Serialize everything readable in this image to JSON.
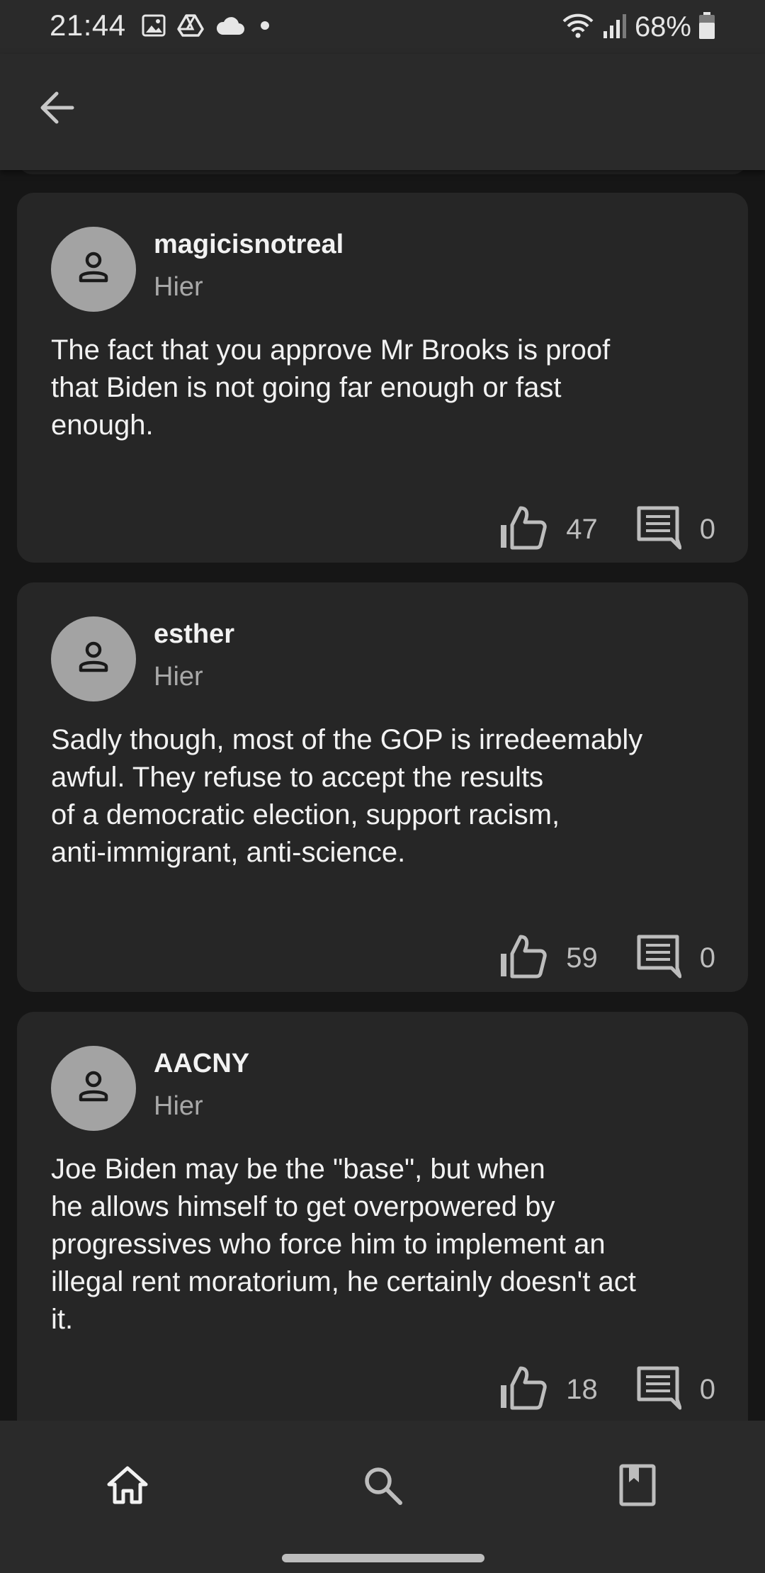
{
  "status_bar": {
    "time": "21:44",
    "battery": "68%",
    "left_icons": [
      "image-icon",
      "drive-icon",
      "cloud-icon",
      "dot-icon"
    ],
    "right_icons": [
      "wifi-icon",
      "signal-icon",
      "battery-icon"
    ]
  },
  "app_bar": {
    "back_icon": "arrow-back-icon"
  },
  "comments": [
    {
      "author": "magicisnotreal",
      "time": "Hier",
      "body": "The fact that you approve Mr Brooks is proof\nthat Biden is not going far enough or fast\nenough.",
      "likes": "47",
      "replies": "0"
    },
    {
      "author": "esther",
      "time": "Hier",
      "body": "Sadly though, most of the GOP is irredeemably\nawful. They refuse to accept the results\nof a democratic election, support racism,\nanti-immigrant, anti-science.",
      "likes": "59",
      "replies": "0"
    },
    {
      "author": "AACNY",
      "time": "Hier",
      "body": "Joe Biden may be the \"base\", but when\nhe allows himself to get overpowered by\nprogressives who force him to implement an\nillegal rent moratorium, he certainly doesn't act\nit.",
      "likes": "18",
      "replies": "0"
    }
  ],
  "bottom_nav": {
    "items": [
      "home-icon",
      "search-icon",
      "bookmark-icon"
    ]
  },
  "colors": {
    "background": "#161616",
    "card": "#262626",
    "bar": "#2a2a2a",
    "text": "#f2f2f2",
    "muted": "#a8a8a8",
    "avatar": "#a3a3a3"
  }
}
